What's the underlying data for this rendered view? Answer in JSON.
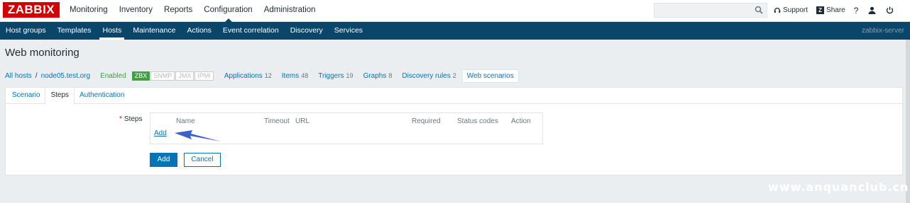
{
  "logo": "ZABBIX",
  "top_menu": [
    "Monitoring",
    "Inventory",
    "Reports",
    "Configuration",
    "Administration"
  ],
  "top_menu_selected": "Configuration",
  "top_links": {
    "support": "Support",
    "share": "Share",
    "share_badge": "Z",
    "help": "?"
  },
  "sub_menu": [
    "Host groups",
    "Templates",
    "Hosts",
    "Maintenance",
    "Actions",
    "Event correlation",
    "Discovery",
    "Services"
  ],
  "sub_menu_selected": "Hosts",
  "server_name": "zabbix-server",
  "page_title": "Web monitoring",
  "host_nav": {
    "all_hosts": "All hosts",
    "separator": "/",
    "host": "node05.test.org",
    "status": "Enabled",
    "badges": [
      "ZBX",
      "SNMP",
      "JMX",
      "IPMI"
    ],
    "links": [
      {
        "label": "Applications",
        "count": "12"
      },
      {
        "label": "Items",
        "count": "48"
      },
      {
        "label": "Triggers",
        "count": "19"
      },
      {
        "label": "Graphs",
        "count": "8"
      },
      {
        "label": "Discovery rules",
        "count": "2"
      }
    ],
    "current": "Web scenarios"
  },
  "tabs": [
    "Scenario",
    "Steps",
    "Authentication"
  ],
  "tab_selected": "Steps",
  "steps": {
    "required_mark": "*",
    "label": "Steps",
    "columns": [
      "Name",
      "Timeout",
      "URL",
      "Required",
      "Status codes",
      "Action"
    ],
    "add_link": "Add"
  },
  "buttons": {
    "add": "Add",
    "cancel": "Cancel"
  },
  "watermark": "www.anquanclub.cn",
  "colors": {
    "brand": "#d40000",
    "nav": "#0a466a",
    "link": "#0275b8",
    "enabled": "#429e47",
    "arrow": "#3a5fcd"
  }
}
